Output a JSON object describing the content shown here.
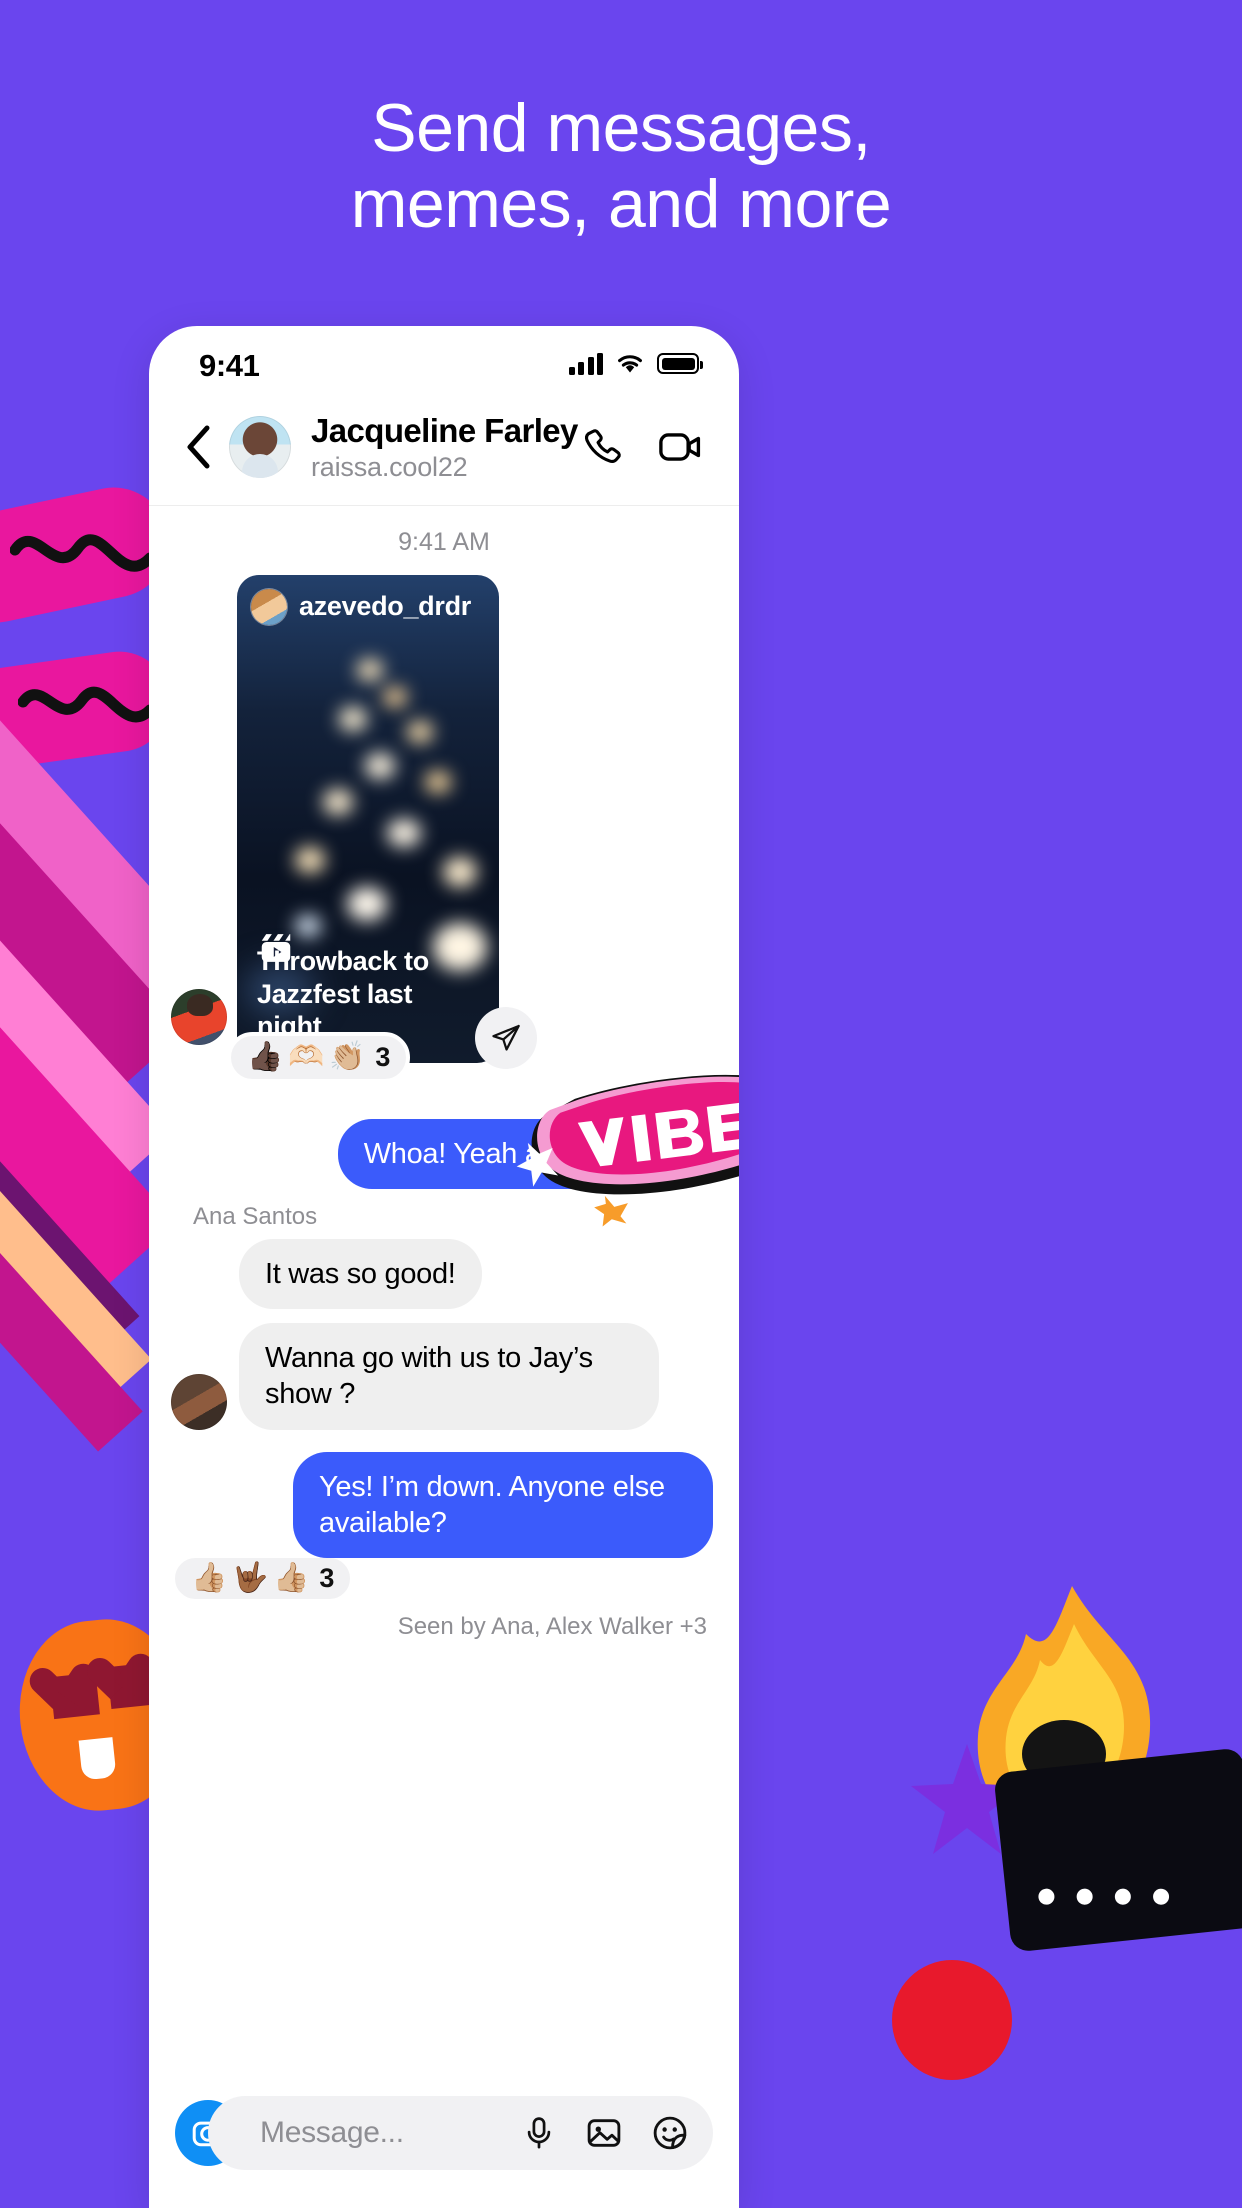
{
  "headline": {
    "line1": "Send messages,",
    "line2": "memes, and more"
  },
  "theme": {
    "background": "#6A45EE",
    "outgoing_bubble": "#3B5BFB",
    "incoming_bubble": "#EFEFEF",
    "camera_blue": "#0F8FF5"
  },
  "phone": {
    "statusbar": {
      "time": "9:41",
      "signal_icon": "cellular-bars-icon",
      "wifi_icon": "wifi-icon",
      "battery_icon": "battery-icon"
    },
    "header": {
      "back_icon": "back-chevron-icon",
      "avatar": "contact-avatar",
      "name": "Jacqueline Farley",
      "handle": "raissa.cool22",
      "call_icon": "phone-call-icon",
      "video_icon": "video-camera-icon"
    },
    "thread": {
      "daystamp": "9:41 AM",
      "story": {
        "username": "azevedo_drdr",
        "caption_line1": "Throwback to",
        "caption_line2": "Jazzfest last night",
        "reel_icon": "reels-icon",
        "share_icon": "share-paper-plane-icon",
        "reactions": {
          "emojis": [
            "👍🏿",
            "🫶🏻",
            "👏🏼"
          ],
          "count": "3"
        }
      },
      "sticker": {
        "name": "vibes-graffiti-sticker",
        "text": "VIBES"
      },
      "messages": [
        {
          "id": "m1",
          "side": "out",
          "text": "Whoa! Yeah also saw this"
        },
        {
          "id": "m2",
          "side": "in",
          "sender": "Ana Santos",
          "text": "It was so good!"
        },
        {
          "id": "m3",
          "side": "in",
          "text": "Wanna go with us to Jay’s show ?"
        },
        {
          "id": "m4",
          "side": "out",
          "text": "Yes! I’m down. Anyone else available?"
        }
      ],
      "outgoing_reactions": {
        "emojis": [
          "👍🏼",
          "🤟🏾",
          "👍🏼"
        ],
        "count": "3"
      },
      "seen_by": "Seen by Ana, Alex Walker +3"
    },
    "composer": {
      "camera_icon": "camera-icon",
      "placeholder": "Message...",
      "mic_icon": "microphone-icon",
      "gallery_icon": "photo-gallery-icon",
      "sticker_icon": "sticker-smiley-icon"
    }
  }
}
